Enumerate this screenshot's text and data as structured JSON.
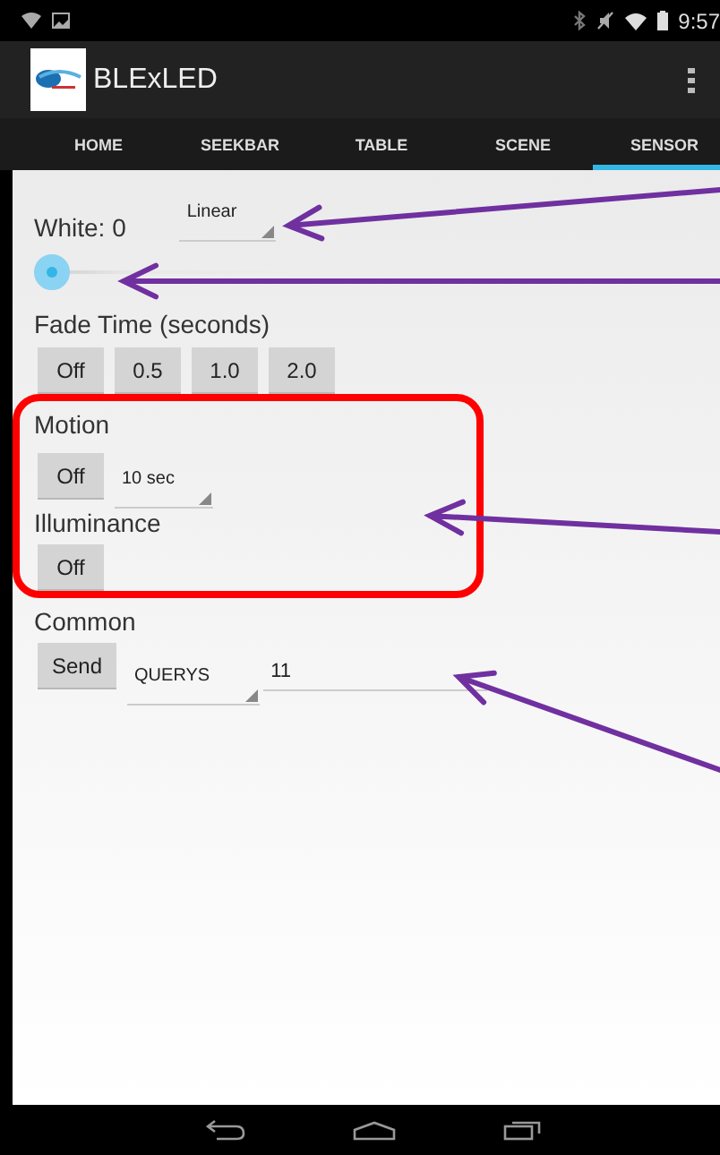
{
  "status_bar": {
    "time": "9:57"
  },
  "action_bar": {
    "title": "BLExLED"
  },
  "tabs": [
    {
      "label": "HOME",
      "selected": false
    },
    {
      "label": "SEEKBAR",
      "selected": false
    },
    {
      "label": "TABLE",
      "selected": false
    },
    {
      "label": "SCENE",
      "selected": false
    },
    {
      "label": "SENSOR",
      "selected": true
    }
  ],
  "white": {
    "label": "White: 0",
    "mode": "Linear",
    "level": 0
  },
  "fade": {
    "label": "Fade Time (seconds)",
    "buttons": [
      "Off",
      "0.5",
      "1.0",
      "2.0"
    ]
  },
  "motion": {
    "label": "Motion",
    "button": "Off",
    "interval": "10 sec"
  },
  "illuminance": {
    "label": "Illuminance",
    "button": "Off"
  },
  "common": {
    "label": "Common",
    "button": "Send",
    "command": "QUERYS",
    "value": "11"
  }
}
